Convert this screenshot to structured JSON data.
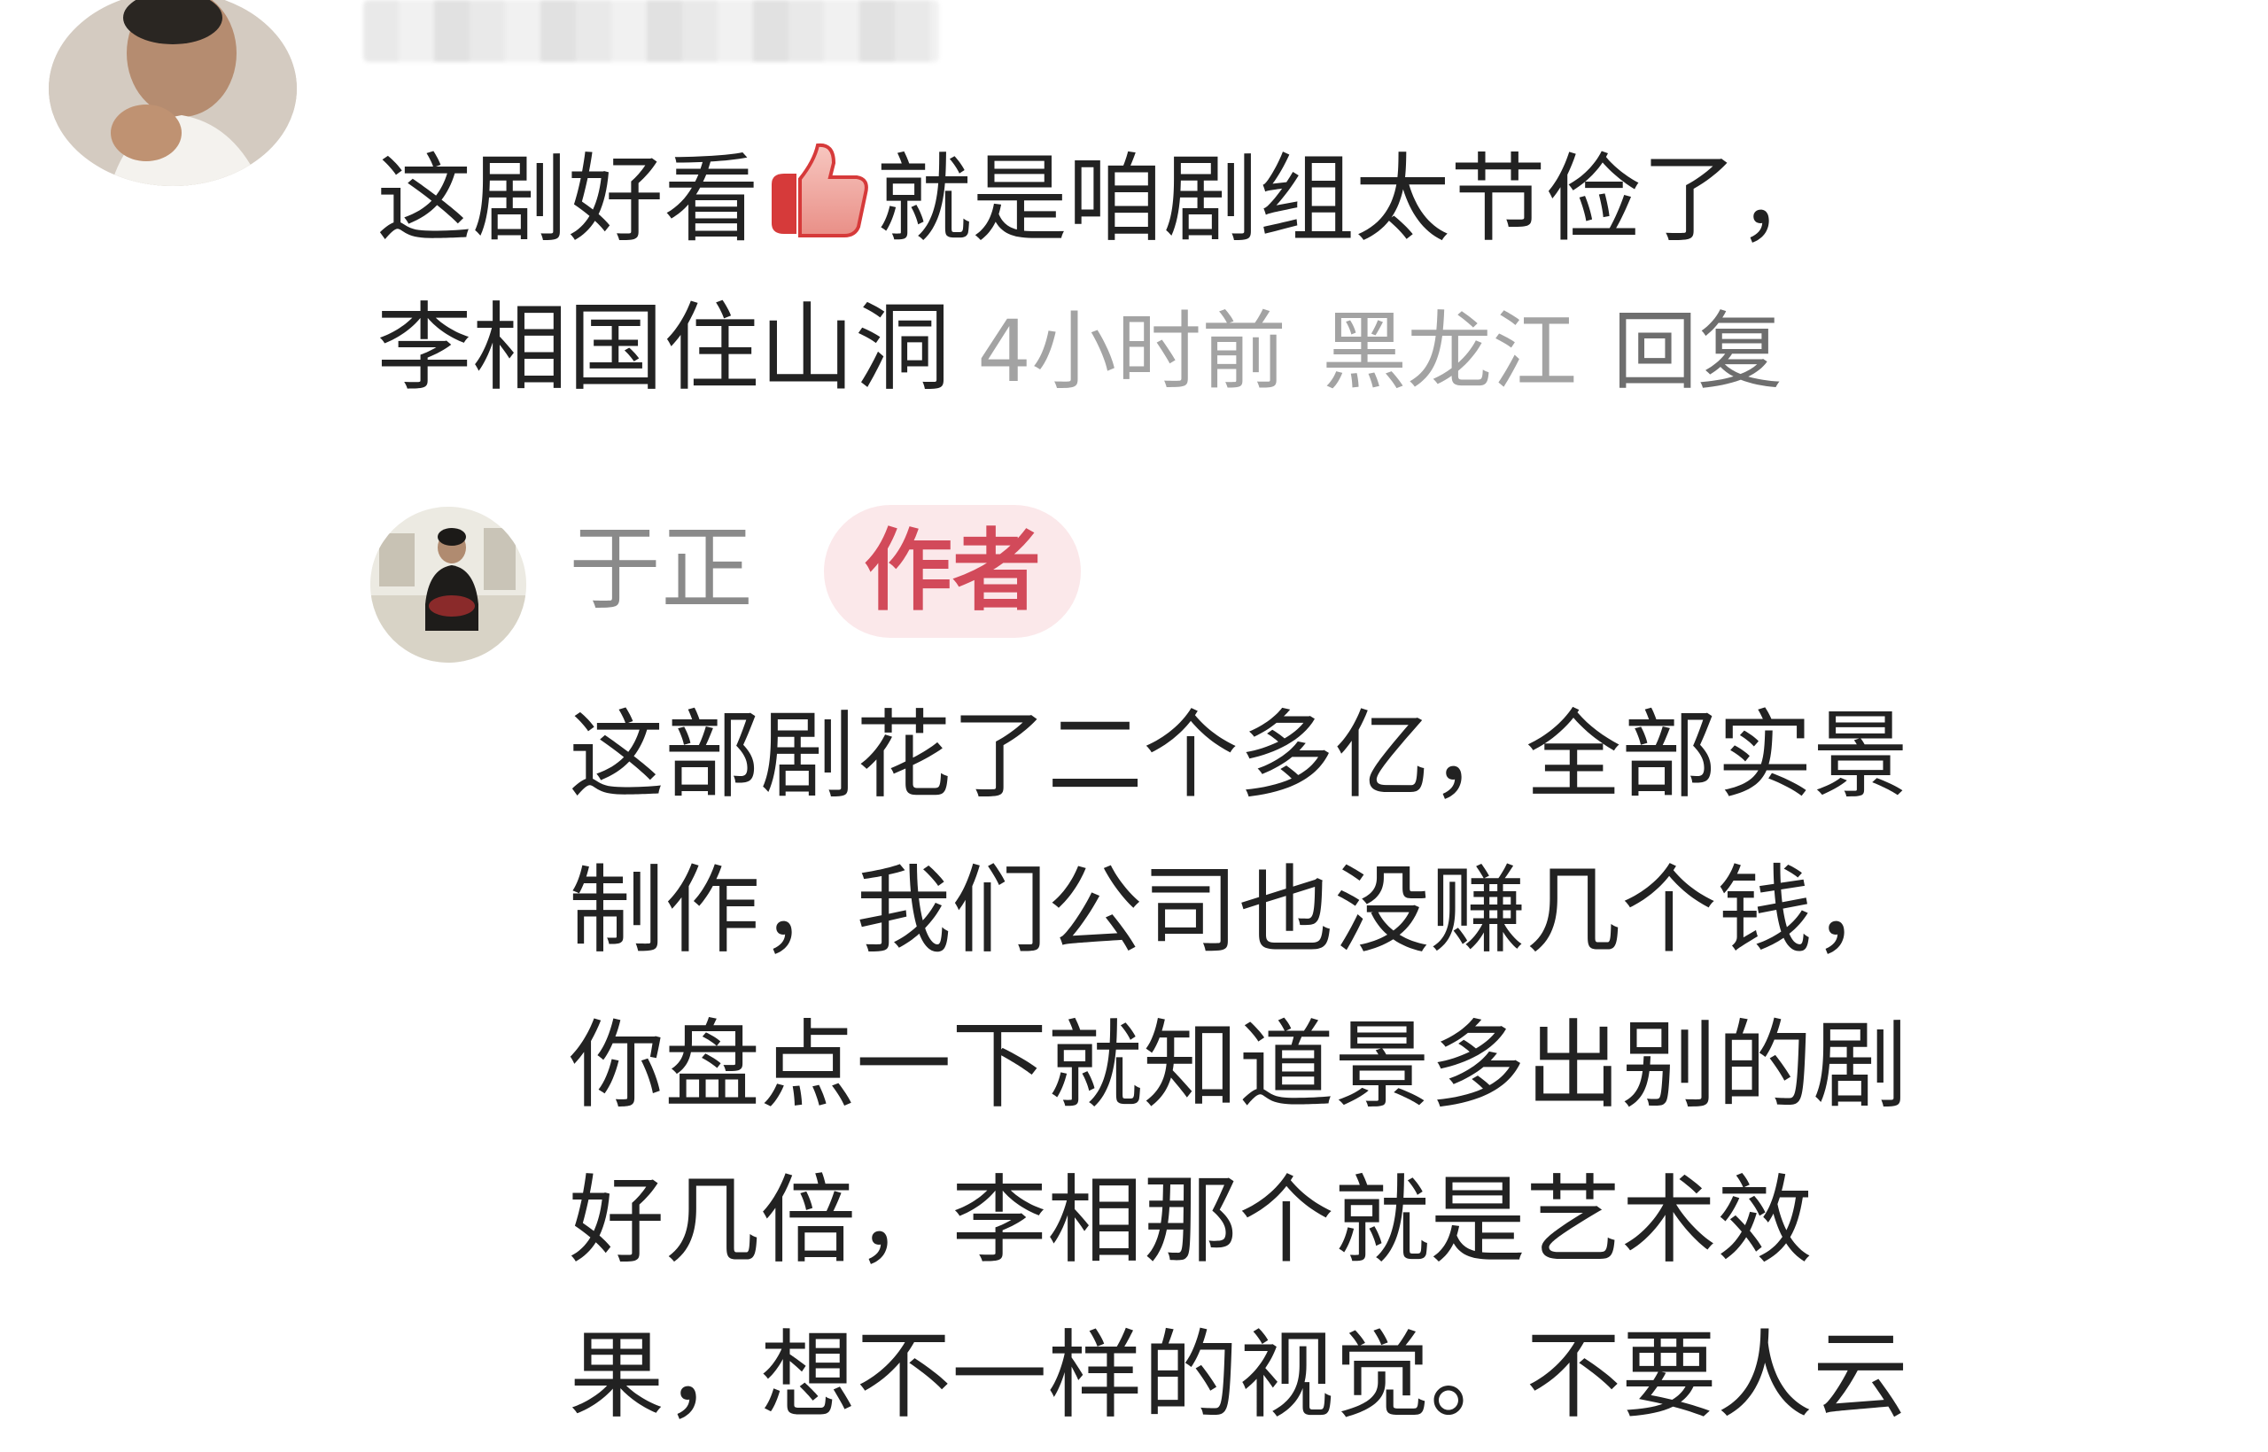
{
  "comment": {
    "line1_before_emoji": "这剧好看",
    "emoji": "thumbs-up-emoji",
    "line1_after_emoji": "就是咱剧组太节俭了，",
    "line2_text": "李相国住山洞",
    "time": "4小时前",
    "location": "黑龙江",
    "reply_label": "回复"
  },
  "reply": {
    "username": "于正",
    "badge": "作者",
    "lines": [
      "这部剧花了二个多亿，全部实景",
      "制作，我们公司也没赚几个钱，",
      "你盘点一下就知道景多出别的剧",
      "好几倍，李相那个就是艺术效",
      "果，想不一样的视觉。不要人云"
    ]
  },
  "colors": {
    "text": "#222222",
    "meta": "#a3a3a3",
    "reply_link": "#6e6e6e",
    "username": "#8a8a8a",
    "badge_bg": "#fbe8ea",
    "badge_text": "#d24a5a"
  }
}
